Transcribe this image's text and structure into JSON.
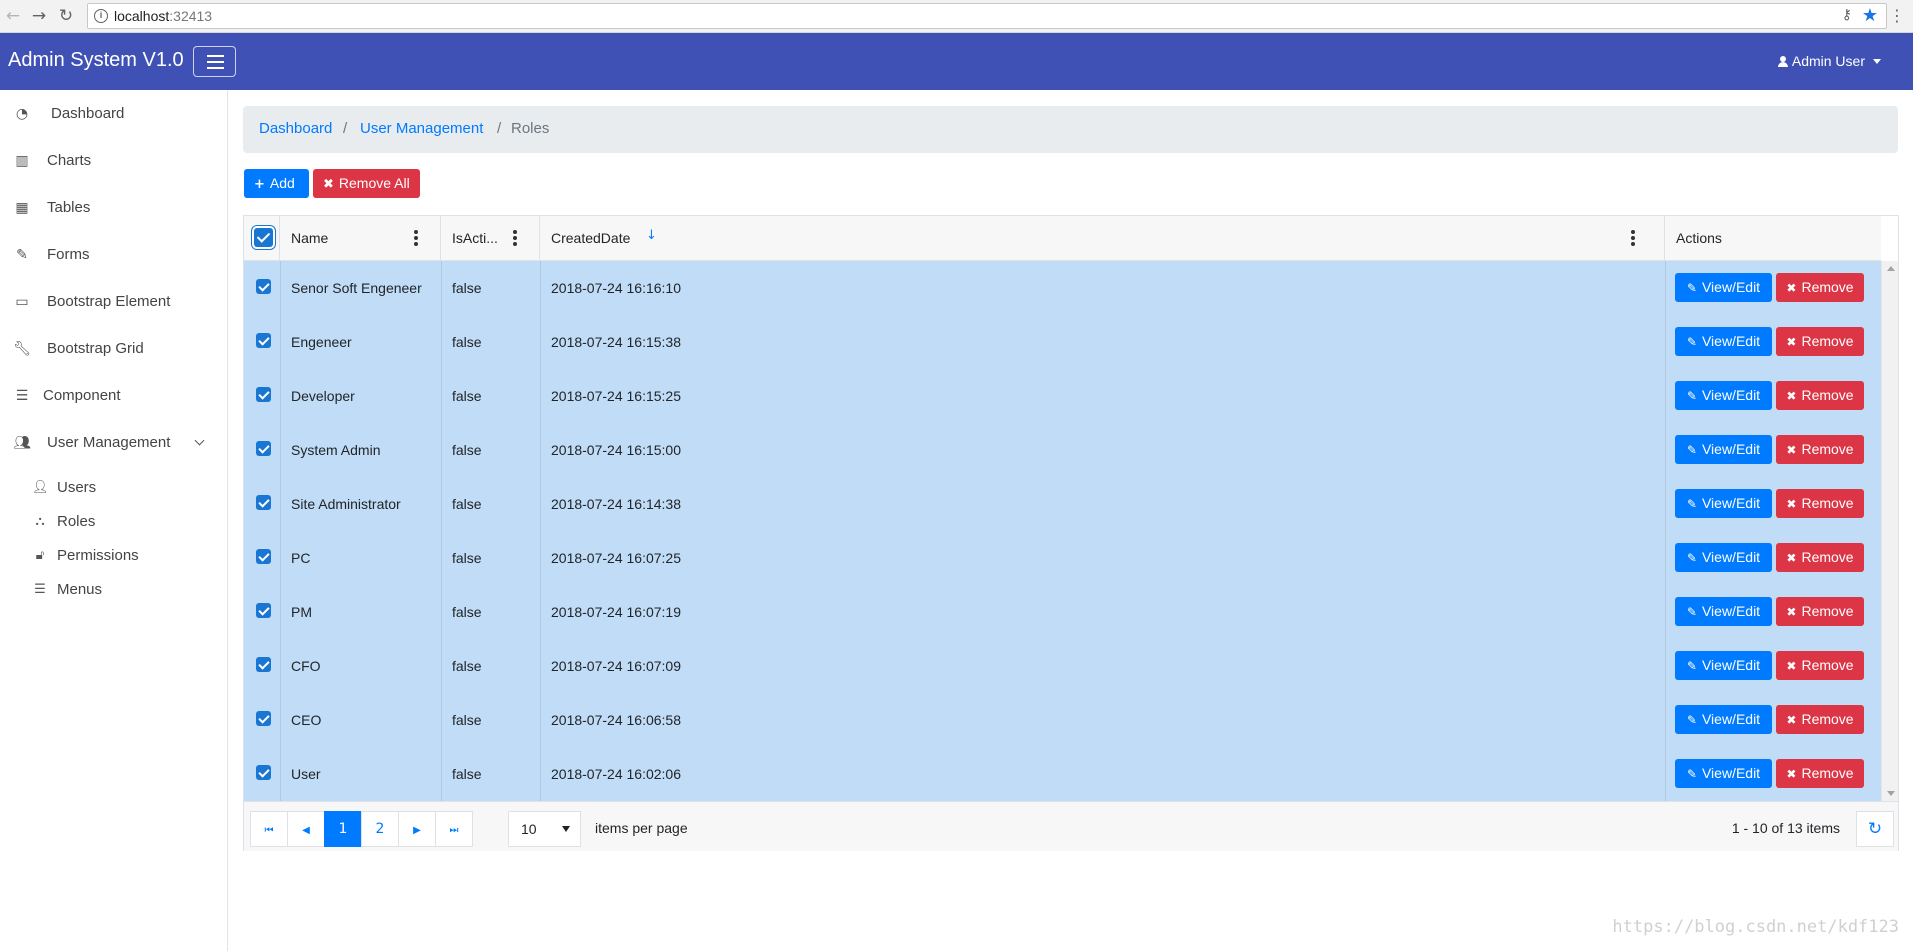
{
  "browser": {
    "url_host": "localhost",
    "url_port": ":32413",
    "back_icon": "arrow-left-icon",
    "forward_icon": "arrow-right-icon",
    "reload_icon": "reload-icon"
  },
  "navbar": {
    "brand": "Admin System V1.0",
    "user": "Admin User",
    "color": "#3f51b5"
  },
  "sidebar": {
    "items": [
      {
        "label": "Dashboard",
        "icon": "dashboard-icon"
      },
      {
        "label": "Charts",
        "icon": "bar-chart-icon"
      },
      {
        "label": "Tables",
        "icon": "table-icon"
      },
      {
        "label": "Forms",
        "icon": "edit-icon"
      },
      {
        "label": "Bootstrap Element",
        "icon": "desktop-icon"
      },
      {
        "label": "Bootstrap Grid",
        "icon": "wrench-icon"
      },
      {
        "label": "Component",
        "icon": "list-icon"
      },
      {
        "label": "User Management",
        "icon": "users-icon"
      }
    ],
    "subitems": [
      {
        "label": "Users",
        "icon": "user-icon"
      },
      {
        "label": "Roles",
        "icon": "sitemap-icon"
      },
      {
        "label": "Permissions",
        "icon": "unlock-icon"
      },
      {
        "label": "Menus",
        "icon": "bars-icon"
      }
    ]
  },
  "breadcrumb": {
    "items": [
      "Dashboard",
      "User Management"
    ],
    "separator": "/",
    "current": "Roles"
  },
  "toolbar": {
    "add_label": "Add",
    "remove_all_label": "Remove All",
    "add_color": "#007bff",
    "remove_color": "#dc3545"
  },
  "grid": {
    "columns": {
      "name": "Name",
      "is_active": "IsActi...",
      "created": "CreatedDate",
      "actions": "Actions"
    },
    "edit_label": "View/Edit",
    "remove_label": "Remove",
    "selected_color": "#c0dcf6",
    "rows": [
      {
        "name": "Senor Soft Engeneer",
        "is_active": "false",
        "created": "2018-07-24 16:16:10"
      },
      {
        "name": "Engeneer",
        "is_active": "false",
        "created": "2018-07-24 16:15:38"
      },
      {
        "name": "Developer",
        "is_active": "false",
        "created": "2018-07-24 16:15:25"
      },
      {
        "name": "System Admin",
        "is_active": "false",
        "created": "2018-07-24 16:15:00"
      },
      {
        "name": "Site Administrator",
        "is_active": "false",
        "created": "2018-07-24 16:14:38"
      },
      {
        "name": "PC",
        "is_active": "false",
        "created": "2018-07-24 16:07:25"
      },
      {
        "name": "PM",
        "is_active": "false",
        "created": "2018-07-24 16:07:19"
      },
      {
        "name": "CFO",
        "is_active": "false",
        "created": "2018-07-24 16:07:09"
      },
      {
        "name": "CEO",
        "is_active": "false",
        "created": "2018-07-24 16:06:58"
      },
      {
        "name": "User",
        "is_active": "false",
        "created": "2018-07-24 16:02:06"
      }
    ]
  },
  "pager": {
    "pages": [
      "1",
      "2"
    ],
    "current_page": "1",
    "page_size": "10",
    "items_per_page_label": "items per page",
    "info": "1 - 10 of 13 items"
  },
  "watermark": "https://blog.csdn.net/kdf123"
}
